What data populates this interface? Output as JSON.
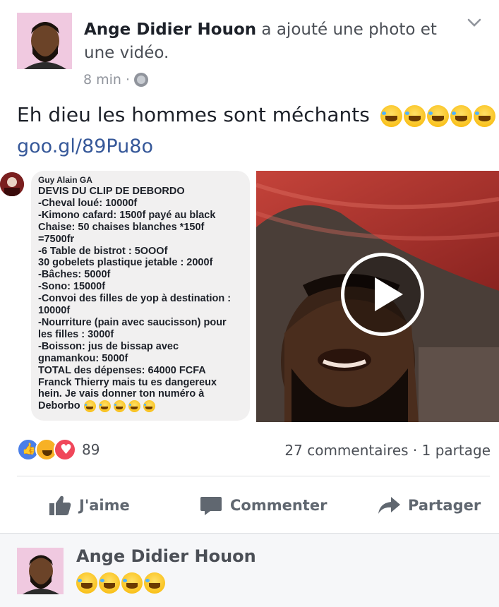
{
  "post": {
    "author": "Ange Didier Houon",
    "action_text": " a ajouté une photo et une vidéo.",
    "time": "8 min",
    "separator": "·",
    "privacy_icon": "globe-icon",
    "text": "Eh dieu les hommes sont méchants",
    "text_emojis": [
      "laughing-tears",
      "laughing-tears",
      "laughing-tears",
      "laughing-tears",
      "laughing-tears"
    ],
    "link": "goo.gl/89Pu8o"
  },
  "chat_screenshot": {
    "sender": "Guy Alain GA",
    "lines": [
      "DEVIS DU CLIP DE DEBORDO",
      "-Cheval loué: 10000f",
      "-Kimono cafard: 1500f payé au black",
      "Chaise: 50 chaises blanches *150f",
      "=7500fr",
      "-6 Table de bistrot : 5OOOf",
      "30 gobelets plastique jetable : 2000f",
      "-Bâches: 5000f",
      "-Sono: 15000f",
      "-Convoi des filles de yop à destination :",
      "10000f",
      "-Nourriture (pain avec saucisson) pour",
      "les filles : 3000f",
      "-Boisson:  jus de bissap avec",
      "gnamankou: 5000f",
      "TOTAL des dépenses: 64000 FCFA",
      "Franck Thierry mais tu es dangereux",
      "hein. Je vais donner ton numéro à"
    ],
    "last_line": "Deborbo",
    "last_line_emojis": 5
  },
  "video": {
    "play_icon": "play-icon"
  },
  "engagement": {
    "reaction_icons": [
      "like-icon",
      "haha-icon",
      "love-icon"
    ],
    "reaction_count": "89",
    "comments": "27 commentaires",
    "dot": "·",
    "shares": "1 partage"
  },
  "actions": {
    "like": "J'aime",
    "comment": "Commenter",
    "share": "Partager"
  },
  "comment": {
    "author": "Ange Didier Houon",
    "emoji_count": 4
  },
  "colors": {
    "link": "#365899",
    "text": "#1d2129",
    "muted": "#90949c",
    "like": "#4a7fe8",
    "love": "#f0475a",
    "haha": "#f7b125"
  }
}
